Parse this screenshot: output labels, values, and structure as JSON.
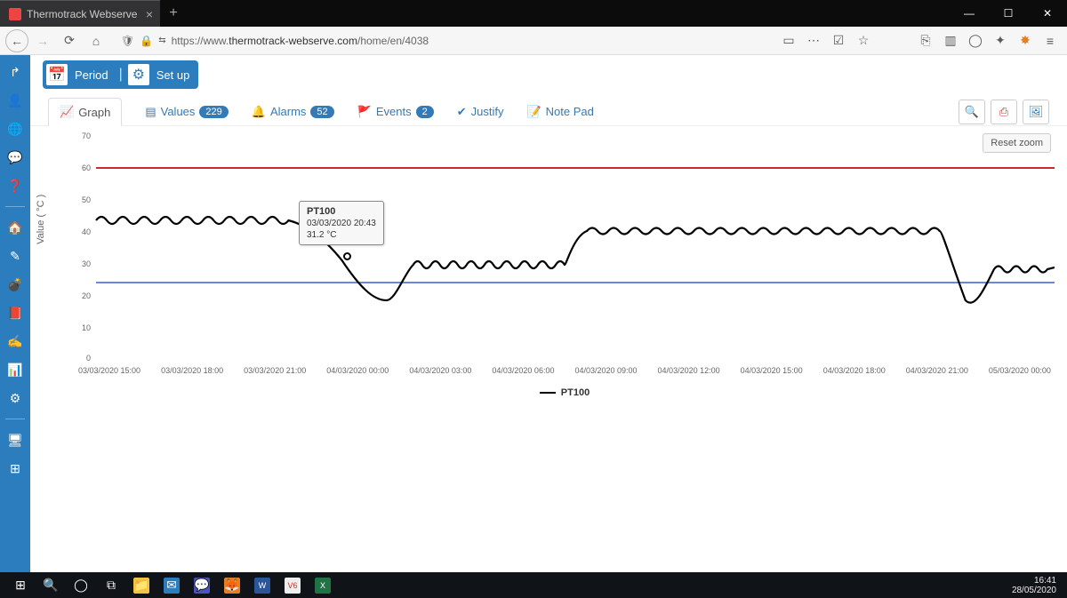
{
  "browser": {
    "tab_title": "Thermotrack Webserve",
    "url_host": "https://www.",
    "url_main": "thermotrack-webserve.com",
    "url_path": "/home/en/4038"
  },
  "actions": {
    "period": "Period",
    "setup": "Set up"
  },
  "tabs": {
    "graph": "Graph",
    "values": "Values",
    "values_badge": "229",
    "alarms": "Alarms",
    "alarms_badge": "52",
    "events": "Events",
    "events_badge": "2",
    "justify": "Justify",
    "notepad": "Note Pad"
  },
  "chart": {
    "reset": "Reset zoom",
    "ylabel": "Value ( °C )",
    "legend": "PT100",
    "tooltip": {
      "series": "PT100",
      "ts": "03/03/2020 20:43",
      "val": "31.2 °C"
    }
  },
  "xticks": [
    "03/03/2020 15:00",
    "03/03/2020 18:00",
    "03/03/2020 21:00",
    "04/03/2020 00:00",
    "04/03/2020 03:00",
    "04/03/2020 06:00",
    "04/03/2020 09:00",
    "04/03/2020 12:00",
    "04/03/2020 15:00",
    "04/03/2020 18:00",
    "04/03/2020 21:00",
    "05/03/2020 00:00"
  ],
  "yticks": [
    "70",
    "60",
    "50",
    "40",
    "30",
    "20",
    "10",
    "0"
  ],
  "tray": {
    "time": "16:41",
    "date": "28/05/2020"
  },
  "chart_data": {
    "type": "line",
    "title": "",
    "xlabel": "",
    "ylabel": "Value ( °C )",
    "ylim": [
      0,
      70
    ],
    "thresholds": {
      "upper": 60,
      "lower": 25
    },
    "x": [
      "03/03/2020 15:00",
      "03/03/2020 18:00",
      "03/03/2020 21:00",
      "04/03/2020 00:00",
      "04/03/2020 03:00",
      "04/03/2020 06:00",
      "04/03/2020 09:00",
      "04/03/2020 12:00",
      "04/03/2020 15:00",
      "04/03/2020 18:00",
      "04/03/2020 21:00",
      "05/03/2020 00:00"
    ],
    "series": [
      {
        "name": "PT100",
        "values": [
          44,
          43,
          31,
          29,
          30,
          40,
          41,
          41,
          41,
          41,
          23,
          29
        ]
      }
    ],
    "tooltip_point": {
      "x": "03/03/2020 20:43",
      "y": 31.2
    }
  }
}
